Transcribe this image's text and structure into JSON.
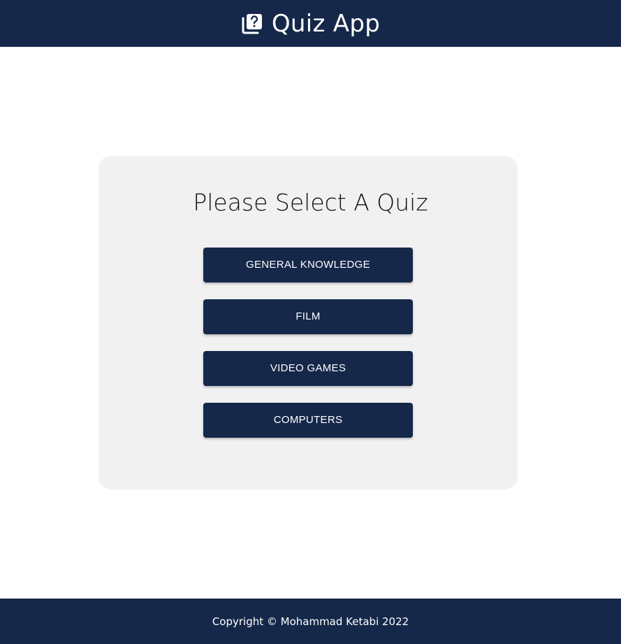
{
  "header": {
    "title": "Quiz App",
    "icon": "quiz-icon"
  },
  "main": {
    "heading": "Please Select A Quiz",
    "quizzes": [
      {
        "label": "GENERAL KNOWLEDGE"
      },
      {
        "label": "FILM"
      },
      {
        "label": "VIDEO GAMES"
      },
      {
        "label": "COMPUTERS"
      }
    ]
  },
  "footer": {
    "copyright": "Copyright © Mohammad Ketabi 2022"
  },
  "colors": {
    "brand": "#15284a",
    "card_background": "#f1f1f1",
    "background": "#ffffff"
  }
}
